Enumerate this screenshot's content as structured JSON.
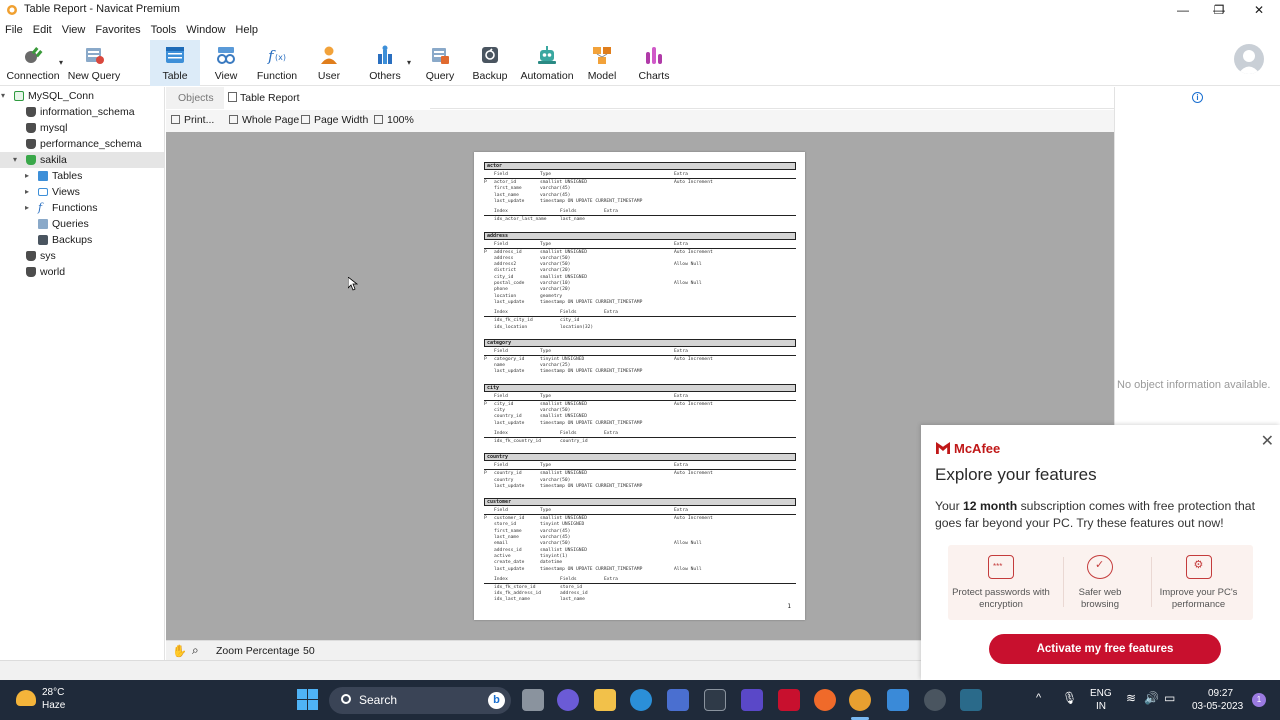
{
  "window": {
    "title": "Table Report - Navicat Premium",
    "minimize_glyph": "—",
    "maximize_glyph": "❐",
    "close_glyph": "✕"
  },
  "menu": [
    "File",
    "Edit",
    "View",
    "Favorites",
    "Tools",
    "Window",
    "Help"
  ],
  "toolbar": {
    "connection": "Connection",
    "new_query": "New Query",
    "table": "Table",
    "view": "View",
    "function": "Function",
    "user": "User",
    "others": "Others",
    "query": "Query",
    "backup": "Backup",
    "automation": "Automation",
    "model": "Model",
    "charts": "Charts"
  },
  "sidebar": {
    "connection": "MySQL_Conn",
    "databases": [
      "information_schema",
      "mysql",
      "performance_schema",
      "sakila",
      "sys",
      "world"
    ],
    "sakila_children": [
      "Tables",
      "Views",
      "Functions",
      "Queries",
      "Backups"
    ]
  },
  "tabs": {
    "objects": "Objects",
    "table_report": "Table Report"
  },
  "report_toolbar": {
    "print": "Print...",
    "whole_page": "Whole Page",
    "page_width": "Page Width",
    "zoom": "100%"
  },
  "report": {
    "header_field": "Field",
    "header_type": "Type",
    "header_extra": "Extra",
    "header_index": "Index",
    "header_fields": "Fields",
    "page_number": "1",
    "tables": [
      {
        "name": "actor",
        "rows": [
          [
            "P",
            "actor_id",
            "smallint UNSIGNED",
            "Auto Increment"
          ],
          [
            "",
            "first_name",
            "varchar(45)",
            ""
          ],
          [
            "",
            "last_name",
            "varchar(45)",
            ""
          ],
          [
            "",
            "last_update",
            "timestamp ON UPDATE CURRENT_TIMESTAMP",
            ""
          ]
        ],
        "indexes": [
          [
            "idx_actor_last_name",
            "last_name"
          ]
        ]
      },
      {
        "name": "address",
        "rows": [
          [
            "P",
            "address_id",
            "smallint UNSIGNED",
            "Auto Increment"
          ],
          [
            "",
            "address",
            "varchar(50)",
            ""
          ],
          [
            "",
            "address2",
            "varchar(50)",
            "Allow Null"
          ],
          [
            "",
            "district",
            "varchar(20)",
            ""
          ],
          [
            "",
            "city_id",
            "smallint UNSIGNED",
            ""
          ],
          [
            "",
            "postal_code",
            "varchar(10)",
            "Allow Null"
          ],
          [
            "",
            "phone",
            "varchar(20)",
            ""
          ],
          [
            "",
            "location",
            "geometry",
            ""
          ],
          [
            "",
            "last_update",
            "timestamp ON UPDATE CURRENT_TIMESTAMP",
            ""
          ]
        ],
        "indexes": [
          [
            "idx_fk_city_id",
            "city_id"
          ],
          [
            "idx_location",
            "location(32)"
          ]
        ]
      },
      {
        "name": "category",
        "rows": [
          [
            "P",
            "category_id",
            "tinyint UNSIGNED",
            "Auto Increment"
          ],
          [
            "",
            "name",
            "varchar(25)",
            ""
          ],
          [
            "",
            "last_update",
            "timestamp ON UPDATE CURRENT_TIMESTAMP",
            ""
          ]
        ],
        "indexes": []
      },
      {
        "name": "city",
        "rows": [
          [
            "P",
            "city_id",
            "smallint UNSIGNED",
            "Auto Increment"
          ],
          [
            "",
            "city",
            "varchar(50)",
            ""
          ],
          [
            "",
            "country_id",
            "smallint UNSIGNED",
            ""
          ],
          [
            "",
            "last_update",
            "timestamp ON UPDATE CURRENT_TIMESTAMP",
            ""
          ]
        ],
        "indexes": [
          [
            "idx_fk_country_id",
            "country_id"
          ]
        ]
      },
      {
        "name": "country",
        "rows": [
          [
            "P",
            "country_id",
            "smallint UNSIGNED",
            "Auto Increment"
          ],
          [
            "",
            "country",
            "varchar(50)",
            ""
          ],
          [
            "",
            "last_update",
            "timestamp ON UPDATE CURRENT_TIMESTAMP",
            ""
          ]
        ],
        "indexes": []
      },
      {
        "name": "customer",
        "rows": [
          [
            "P",
            "customer_id",
            "smallint UNSIGNED",
            "Auto Increment"
          ],
          [
            "",
            "store_id",
            "tinyint UNSIGNED",
            ""
          ],
          [
            "",
            "first_name",
            "varchar(45)",
            ""
          ],
          [
            "",
            "last_name",
            "varchar(45)",
            ""
          ],
          [
            "",
            "email",
            "varchar(50)",
            "Allow Null"
          ],
          [
            "",
            "address_id",
            "smallint UNSIGNED",
            ""
          ],
          [
            "",
            "active",
            "tinyint(1)",
            ""
          ],
          [
            "",
            "create_date",
            "datetime",
            ""
          ],
          [
            "",
            "last_update",
            "timestamp ON UPDATE CURRENT_TIMESTAMP",
            "Allow Null"
          ]
        ],
        "indexes": [
          [
            "idx_fk_store_id",
            "store_id"
          ],
          [
            "idx_fk_address_id",
            "address_id"
          ],
          [
            "idx_last_name",
            "last_name"
          ]
        ]
      }
    ]
  },
  "info_panel": {
    "message": "No object information available."
  },
  "statusbar": {
    "zoom_label": "Zoom Percentage",
    "zoom_value": "50"
  },
  "mcafee": {
    "brand": "McAfee",
    "title": "Explore your features",
    "body_pre": "Your ",
    "body_bold": "12 month",
    "body_post": " subscription comes with free protection that goes far beyond your PC. Try these features out now!",
    "features": [
      "Protect passwords with encryption",
      "Safer web browsing",
      "Improve your PC's performance"
    ],
    "button": "Activate my free features",
    "close_glyph": "✕"
  },
  "taskbar": {
    "temperature": "28°C",
    "condition": "Haze",
    "search": "Search",
    "bing_glyph": "b",
    "language": "ENG",
    "region": "IN",
    "time": "09:27",
    "date": "03-05-2023",
    "notification_count": "1",
    "overflow_glyph": "^"
  },
  "colors": {
    "accent": "#1a6fd0",
    "mcafee_red": "#c8102e",
    "preview_bg": "#a8a8a8",
    "taskbar_bg": "#1f2a3a"
  }
}
